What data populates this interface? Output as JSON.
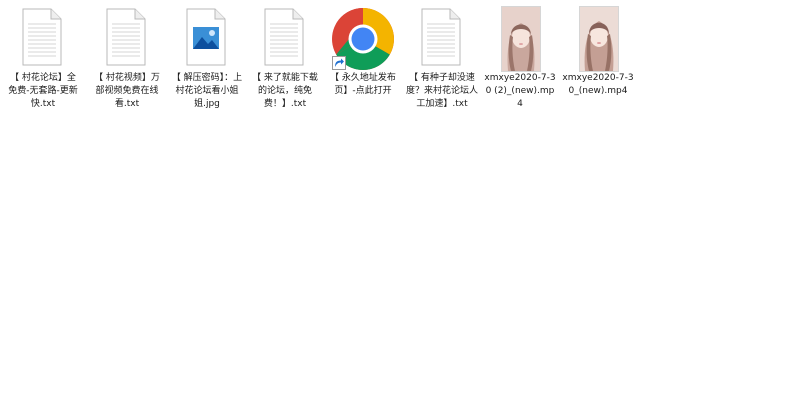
{
  "files": [
    {
      "type": "txt",
      "icon": "text-document-icon",
      "label": "【 村花论坛】全免费-无套路-更新快.txt"
    },
    {
      "type": "txt",
      "icon": "text-document-icon",
      "label": "【 村花视频】万部视频免费在线看.txt"
    },
    {
      "type": "jpg",
      "icon": "image-file-icon",
      "label": "【 解压密码】：上村花论坛看小姐姐.jpg"
    },
    {
      "type": "txt",
      "icon": "text-document-icon",
      "label": "【 来了就能下载的论坛，纯免费！】.txt"
    },
    {
      "type": "url",
      "icon": "chrome-icon",
      "label": "【 永久地址发布页】-点此打开"
    },
    {
      "type": "txt",
      "icon": "text-document-icon",
      "label": "【 有种子却没速度？来村花论坛人工加速】.txt"
    },
    {
      "type": "mp4",
      "icon": "video-thumbnail",
      "label": "xmxye2020-7-30 (2)_(new).mp4"
    },
    {
      "type": "mp4",
      "icon": "video-thumbnail",
      "label": "xmxye2020-7-30_(new).mp4"
    }
  ]
}
